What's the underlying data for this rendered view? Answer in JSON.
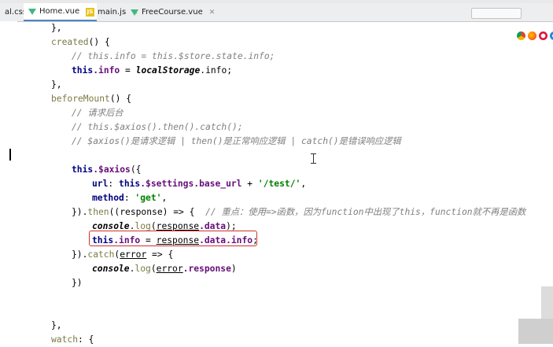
{
  "tabs": {
    "partial_first": "al.css",
    "items": [
      {
        "label": "Home.vue"
      },
      {
        "label": "main.js"
      },
      {
        "label": "FreeCourse.vue"
      }
    ]
  },
  "code": {
    "l1": "},",
    "l2_kw": "created",
    "l2_rest": "() {",
    "l3": "// this.info = this.$store.state.info;",
    "l4_this": "this",
    "l4_info": ".info",
    "l4_eq": " = ",
    "l4_ls": "localStorage",
    "l4_end": ".info;",
    "l5": "},",
    "l6_kw": "beforeMount",
    "l6_rest": "() {",
    "l7": "// 请求后台",
    "l8": "// this.$axios().then().catch();",
    "l9": "// $axios()是请求逻辑 | then()是正常响应逻辑 | catch()是错误响应逻辑",
    "l10_this": "this",
    "l10_ax": ".$axios",
    "l10_end": "({",
    "l11_url": "url",
    "l11_colon": ": ",
    "l11_this": "this",
    "l11_set": ".$settings.",
    "l11_base": "base_url",
    "l11_plus": " + ",
    "l11_str": "'/test/'",
    "l11_comma": ",",
    "l12_m": "method",
    "l12_colon": ": ",
    "l12_str": "'get'",
    "l12_comma": ",",
    "l13_a": "}).",
    "l13_then": "then",
    "l13_b": "((response) => {  ",
    "l13_cmt": "// 重点：使用=>函数，因为function中出现了this，function就不再是函数",
    "l14_cons": "console",
    "l14_dot": ".",
    "l14_log": "log",
    "l14_open": "(",
    "l14_resp": "response",
    "l14_data": ".data",
    "l14_close": ");",
    "l15_this": "this",
    "l15_info": ".info",
    "l15_eq": " = ",
    "l15_resp": "response",
    "l15_data": ".data",
    "l15_info2": ".info",
    "l15_end": ";",
    "l16_a": "}).",
    "l16_catch": "catch",
    "l16_b": "(",
    "l16_err": "error",
    "l16_c": " => {",
    "l17_cons": "console",
    "l17_dot": ".",
    "l17_log": "log",
    "l17_open": "(",
    "l17_err": "error",
    "l17_resp": ".response",
    "l17_close": ")",
    "l18": "})",
    "l19": "},",
    "l20_kw": "watch",
    "l20_rest": ": {"
  },
  "icons": [
    "vue-file-icon",
    "js-file-icon",
    "chrome-icon",
    "firefox-icon",
    "opera-icon",
    "safari-icon"
  ],
  "colors": {
    "keyword": "#000080",
    "string": "#008000",
    "comment": "#808080",
    "property": "#660e7a",
    "highlight_border": "#d0302e"
  }
}
